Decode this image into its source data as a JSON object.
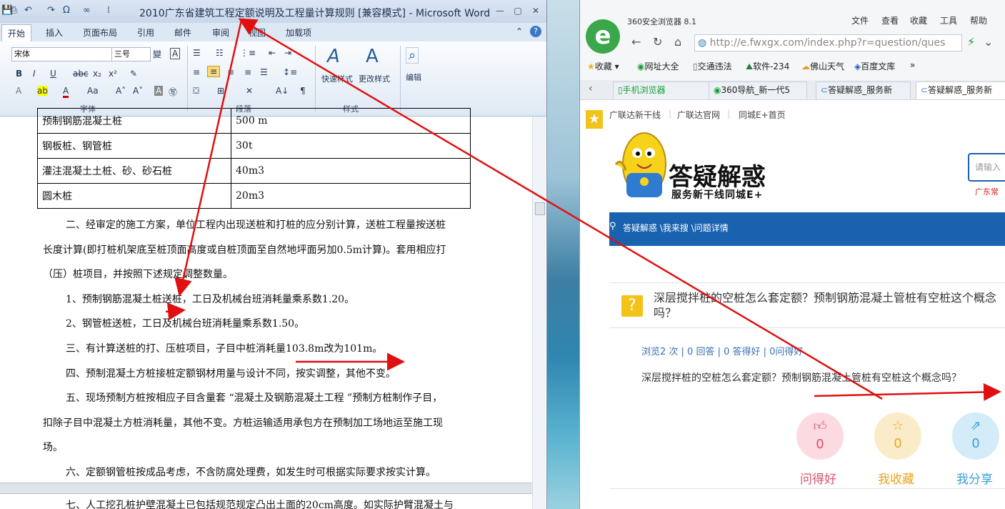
{
  "word": {
    "title": "2010广东省建筑工程定额说明及工程量计算规则 [兼容模式] - Microsoft Word",
    "tabs": [
      "开始",
      "插入",
      "页面布局",
      "引用",
      "邮件",
      "审阅",
      "视图",
      "加载项"
    ],
    "ribbon": {
      "font_name": "宋体",
      "font_size": "三号",
      "groups": [
        "字体",
        "段落",
        "样式"
      ],
      "quick_style": "快速样式",
      "change_style": "更改样式",
      "edit": "编辑"
    },
    "table_rows": [
      {
        "name": "预制钢筋混凝土桩",
        "value": "500 m"
      },
      {
        "name": "钢板桩、钢管桩",
        "value": "30t"
      },
      {
        "name": "灌注混凝土土桩、砂、砂石桩",
        "value": "40m3"
      },
      {
        "name": "圆木桩",
        "value": "20m3"
      }
    ],
    "paragraphs": [
      "二、经审定的施工方案，单位工程内出现送桩和打桩的应分别计算，送桩工程量按送桩",
      "长度计算(即打桩机架底至桩顶面高度或自桩顶面至自然地坪面另加0.5m计算)。套用相应打",
      "（压）桩项目，并按照下述规定调整数量。",
      "1、预制钢筋混凝土桩送桩，工日及机械台班消耗量乘系数1.20。",
      "2、钢管桩送桩，工日及机械台班消耗量乘系数1.50。",
      "三、有计算送桩的打、压桩项目，子目中桩消耗量103.8m改为101m。",
      "四、预制混凝土方桩接桩定额钢材用量与设计不同，按实调整，其他不变。",
      "五、现场预制方桩按相应子目含量套 “混凝土及钢筋混凝土工程 ”预制方桩制作子目，",
      "扣除子目中混凝土方桩消耗量，其他不变。方桩运输适用承包方在预制加工场地运至施工现",
      "场。",
      "六、定额钢管桩按成品考虑，不含防腐处理费，如发生时可根据实际要求按实计算。",
      "七、人工挖孔桩护壁混凝土已包括规范规定凸出土面的20cm高度。如实际护臂混凝土与"
    ]
  },
  "browser": {
    "app_title": "360安全浏览器 8.1",
    "menu": [
      "文件",
      "查看",
      "收藏",
      "工具",
      "帮助"
    ],
    "url": "http://e.fwxgx.com/index.php?r=question/ques",
    "favorites": [
      "收藏",
      "网址大全",
      "交通违法",
      "软件-234",
      "佛山天气",
      "百度文库"
    ],
    "tabs": [
      "手机浏览器",
      "360导航_新一代5",
      "答疑解惑_服务新",
      "答疑解惑_服务新"
    ],
    "top_links": [
      "广联达新干线",
      "广联达官网",
      "同城E+首页"
    ],
    "brand": "答疑解惑",
    "brand_sub": "服务新干线同城E+",
    "search_placeholder": "请输入",
    "red_text": "广东常",
    "breadcrumb": "答疑解惑 \\我来搜 \\问题详情",
    "question_title": "深层搅拌桩的空桩怎么套定额？预制钢筋混凝土管桩有空桩这个概念吗？",
    "stats": "浏览2 次 | 0 回答 | 0 答得好 | 0问得好",
    "question_body": "深层搅拌桩的空桩怎么套定额？预制钢筋混凝土管桩有空桩这个概念吗？",
    "actions": [
      {
        "count": "0",
        "label": "问得好",
        "color": "#e0506a"
      },
      {
        "count": "0",
        "label": "我收藏",
        "color": "#e8a41d"
      },
      {
        "count": "0",
        "label": "我分享",
        "color": "#3aa0d8"
      }
    ]
  }
}
